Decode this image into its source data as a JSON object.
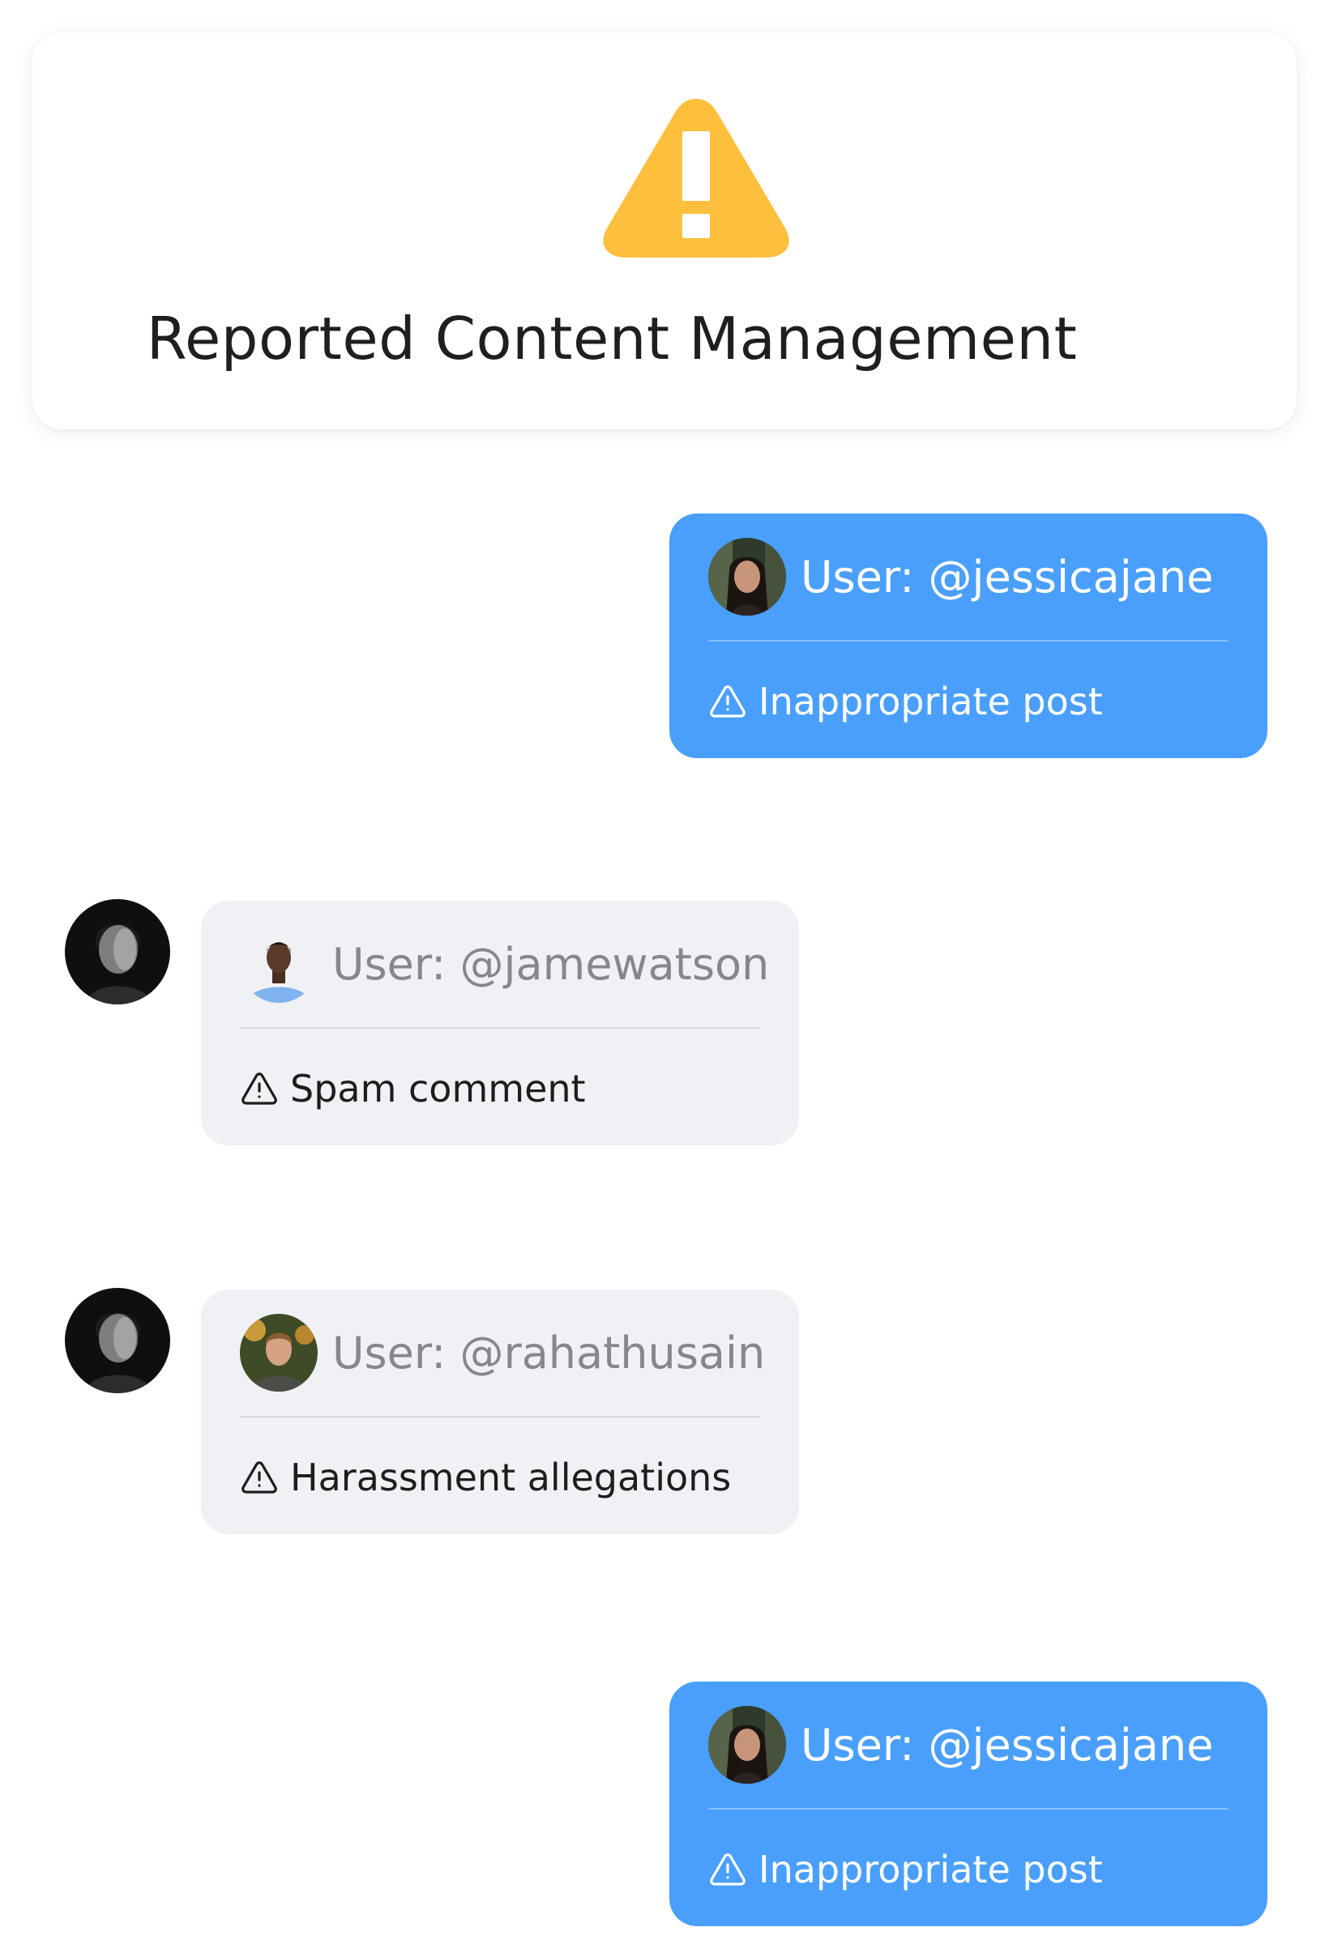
{
  "header": {
    "title": "Reported Content Management",
    "icon": "warning-triangle-icon",
    "icon_color": "#fdbf3c"
  },
  "colors": {
    "outgoing_bubble": "#4a9ffc",
    "incoming_bubble": "#f0f1f4"
  },
  "reports": [
    {
      "direction": "outgoing",
      "user_label": "User: @jessicajane",
      "avatar": "woman-avatar",
      "reason_icon": "alert-triangle-icon",
      "reason": "Inappropriate post"
    },
    {
      "direction": "incoming",
      "sender_avatar": "moderator-avatar",
      "user_label": "User: @jamewatson",
      "avatar": "man-blue-shirt-avatar",
      "reason_icon": "alert-triangle-icon",
      "reason": "Spam comment"
    },
    {
      "direction": "incoming",
      "sender_avatar": "moderator-avatar",
      "user_label": "User: @rahathusain",
      "avatar": "man-outdoor-avatar",
      "reason_icon": "alert-triangle-icon",
      "reason": "Harassment allegations"
    },
    {
      "direction": "outgoing",
      "user_label": "User: @jessicajane",
      "avatar": "woman-avatar",
      "reason_icon": "alert-triangle-icon",
      "reason": "Inappropriate post"
    }
  ]
}
